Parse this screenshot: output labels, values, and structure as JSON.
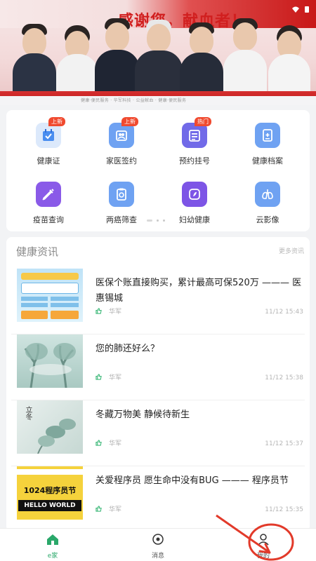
{
  "banner": {
    "title": "感谢您，献血者！",
    "caption": "健康·便民服务  ·  华军科技  ·  公益献血  ·  健康·便民服务"
  },
  "menu": {
    "items": [
      {
        "label": "健康证",
        "badge": "上新",
        "icon": "calendar-check-icon",
        "color": "#4a8ef0"
      },
      {
        "label": "家医签约",
        "badge": "上新",
        "icon": "family-doctor-icon",
        "color": "#4a8ef0"
      },
      {
        "label": "预约挂号",
        "badge": "热门",
        "icon": "registration-icon",
        "color": "#6b63e6"
      },
      {
        "label": "健康档案",
        "badge": "",
        "icon": "health-record-icon",
        "color": "#4a8ef0"
      },
      {
        "label": "疫苗查询",
        "badge": "",
        "icon": "syringe-icon",
        "color": "#8a5ae8"
      },
      {
        "label": "两癌筛查",
        "badge": "",
        "icon": "screening-icon",
        "color": "#4a8ef0"
      },
      {
        "label": "妇幼健康",
        "badge": "",
        "icon": "maternal-child-icon",
        "color": "#7d55e6"
      },
      {
        "label": "云影像",
        "badge": "",
        "icon": "lungs-icon",
        "color": "#4a8ef0"
      }
    ]
  },
  "news": {
    "header": "健康资讯",
    "more": "更多资讯",
    "items": [
      {
        "title": "医保个账直接购买，累计最高可保520万 ——— 医惠锡城",
        "source": "华军",
        "time": "11/12 15:43"
      },
      {
        "title": "您的肺还好么？",
        "source": "华军",
        "time": "11/12 15:38"
      },
      {
        "title": "冬藏万物美 静候待新生",
        "source": "华军",
        "time": "11/12 15:37"
      },
      {
        "title": "关爱程序员 愿生命中没有BUG ——— 程序员节",
        "source": "华军",
        "time": "11/12 15:35"
      }
    ],
    "thumb4_line1": "1024程序员节",
    "thumb4_line2": "HELLO WORLD",
    "thumb3_text": "立冬"
  },
  "nav": {
    "items": [
      {
        "label": "e家",
        "icon": "home-icon",
        "active": true
      },
      {
        "label": "消息",
        "icon": "message-icon",
        "active": false
      },
      {
        "label": "我的",
        "icon": "profile-icon",
        "active": false
      }
    ]
  },
  "colors": {
    "accent_green": "#2aa86a",
    "badge_red": "#f04a2f",
    "annotation_red": "#e23a2a"
  }
}
